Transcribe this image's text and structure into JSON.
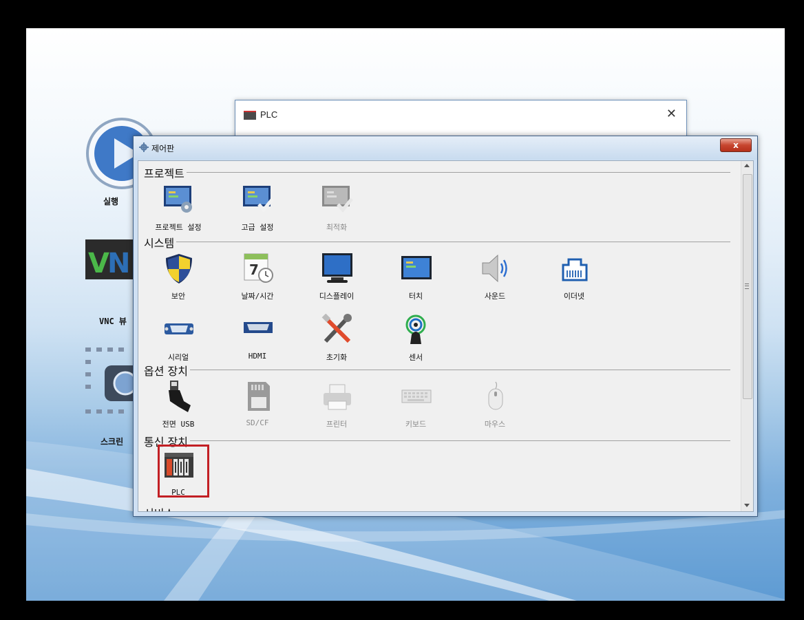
{
  "desktop": {
    "icons": [
      {
        "label": "실행",
        "icon": "play-icon"
      },
      {
        "label": "VNC 뷰",
        "icon": "vnc-icon"
      },
      {
        "label": "스크린",
        "icon": "screen-capture-icon"
      }
    ]
  },
  "plc_dialog": {
    "title": "PLC",
    "close": "✕"
  },
  "control_panel": {
    "title": "제어판",
    "close": "x",
    "sections": [
      {
        "title": "프로젝트",
        "items": [
          {
            "label": "프로젝트 설정",
            "icon": "project-settings-icon",
            "enabled": true
          },
          {
            "label": "고급 설정",
            "icon": "advanced-settings-icon",
            "enabled": true
          },
          {
            "label": "최적화",
            "icon": "optimize-icon",
            "enabled": false
          }
        ]
      },
      {
        "title": "시스템",
        "items": [
          {
            "label": "보안",
            "icon": "security-shield-icon",
            "enabled": true
          },
          {
            "label": "날짜/시간",
            "icon": "calendar-clock-icon",
            "enabled": true
          },
          {
            "label": "디스플레이",
            "icon": "monitor-icon",
            "enabled": true
          },
          {
            "label": "터치",
            "icon": "touch-screen-icon",
            "enabled": true
          },
          {
            "label": "사운드",
            "icon": "speaker-icon",
            "enabled": true
          },
          {
            "label": "이더넷",
            "icon": "ethernet-port-icon",
            "enabled": true
          },
          {
            "label": "시리얼",
            "icon": "serial-port-icon",
            "enabled": true
          },
          {
            "label": "HDMI",
            "icon": "hdmi-port-icon",
            "enabled": true
          },
          {
            "label": "초기화",
            "icon": "tools-reset-icon",
            "enabled": true
          },
          {
            "label": "센서",
            "icon": "sensor-icon",
            "enabled": true
          }
        ]
      },
      {
        "title": "옵션 장치",
        "items": [
          {
            "label": "전면 USB",
            "icon": "usb-plug-icon",
            "enabled": true
          },
          {
            "label": "SD/CF",
            "icon": "sd-card-icon",
            "enabled": false
          },
          {
            "label": "프린터",
            "icon": "printer-icon",
            "enabled": false
          },
          {
            "label": "키보드",
            "icon": "keyboard-icon",
            "enabled": false
          },
          {
            "label": "마우스",
            "icon": "mouse-icon",
            "enabled": false
          }
        ]
      },
      {
        "title": "통신 장치",
        "items": [
          {
            "label": "PLC",
            "icon": "plc-device-icon",
            "enabled": true,
            "selected": true
          }
        ]
      },
      {
        "title": "서비스",
        "items": []
      }
    ]
  }
}
